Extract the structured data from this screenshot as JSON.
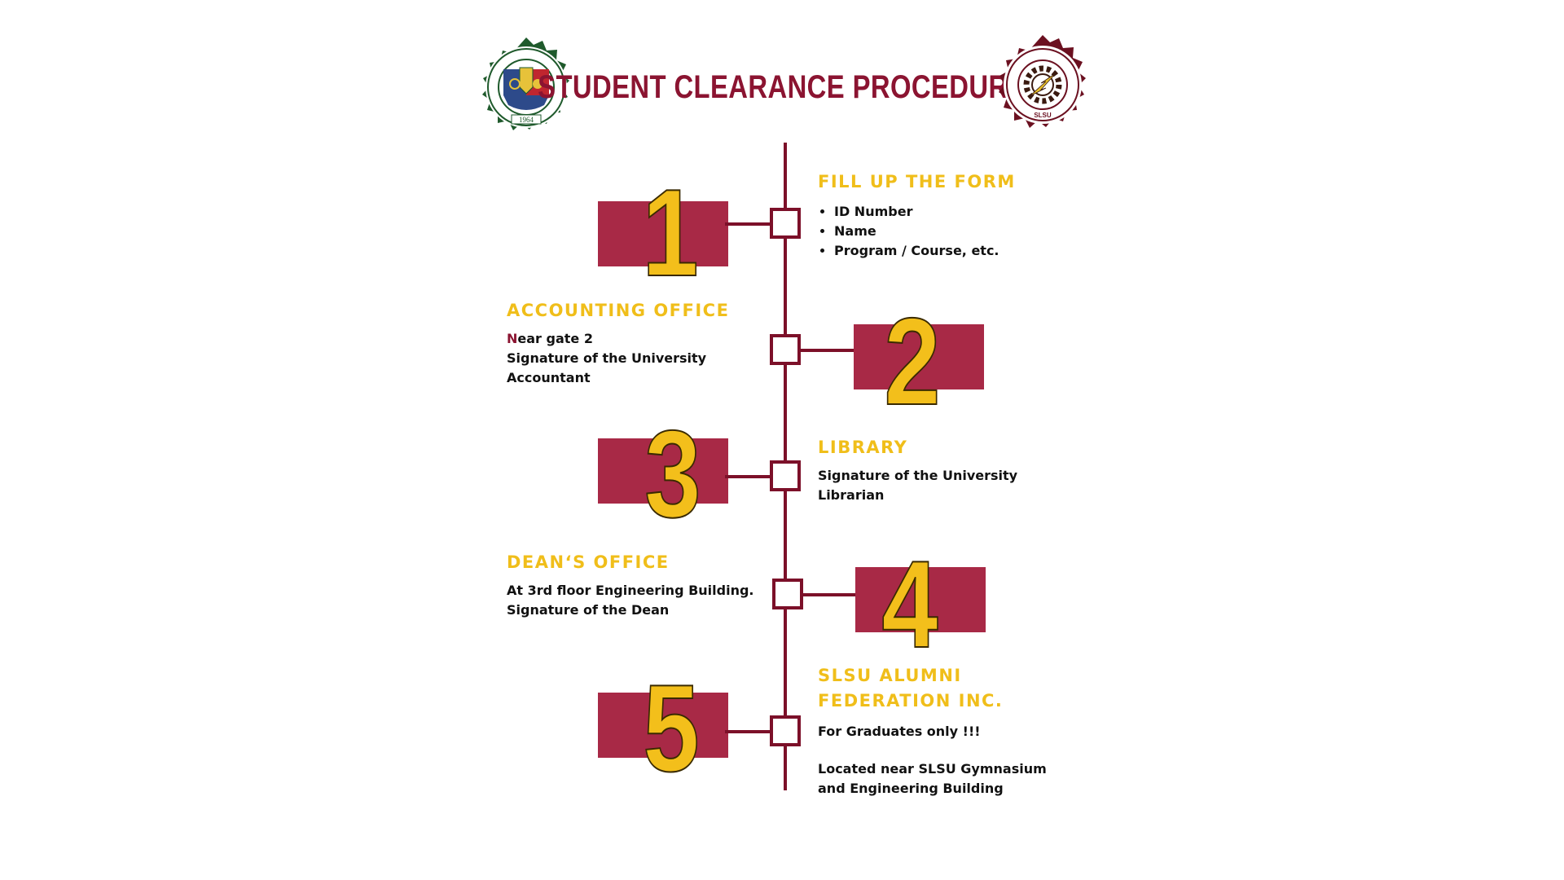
{
  "header": {
    "title": "STUDENT CLEARANCE PROCEDURE",
    "left_seal": {
      "icon": "university-seal-icon",
      "ring_text": "SOUTHERN LUZON STATE UNIVERSITY",
      "year": "1964",
      "colors": {
        "ring": "#1f5a2c",
        "shield_blue": "#2d4a8a",
        "shield_red": "#c0262f",
        "shield_yellow": "#e7c23a"
      }
    },
    "right_seal": {
      "icon": "college-of-engineering-seal-icon",
      "ring_text": "COLLEGE OF ENGINEERING",
      "bottom_text": "SLSU",
      "colors": {
        "ring": "#6b1020",
        "gear": "#3a1a10",
        "bolt": "#e8c12c"
      }
    }
  },
  "steps": [
    {
      "number": "1",
      "heading": "FILL UP THE FORM",
      "items": [
        "ID Number",
        "Name",
        "Program / Course, etc."
      ]
    },
    {
      "number": "2",
      "heading": "ACCOUNTING OFFICE",
      "first_letter": "N",
      "line1_rest": "ear gate 2",
      "line2": "Signature of the University",
      "line3": "Accountant"
    },
    {
      "number": "3",
      "heading": "LIBRARY",
      "line1": "Signature of the University",
      "line2": "Librarian"
    },
    {
      "number": "4",
      "heading": "DEAN‘S OFFICE",
      "line1": "At 3rd floor Engineering Building.",
      "line2": "Signature of the Dean"
    },
    {
      "number": "5",
      "heading_line1": "SLSU ALUMNI",
      "heading_line2": "FEDERATION INC.",
      "line1": "For Graduates only !!!",
      "line2": "Located near SLSU Gymnasium",
      "line3": "and Engineering Building"
    }
  ],
  "colors": {
    "accent_maroon": "#7c1029",
    "block_red": "#a82946",
    "number_yellow": "#f3bf1b",
    "heading_yellow": "#f0be1a",
    "title_red": "#8b1431"
  }
}
